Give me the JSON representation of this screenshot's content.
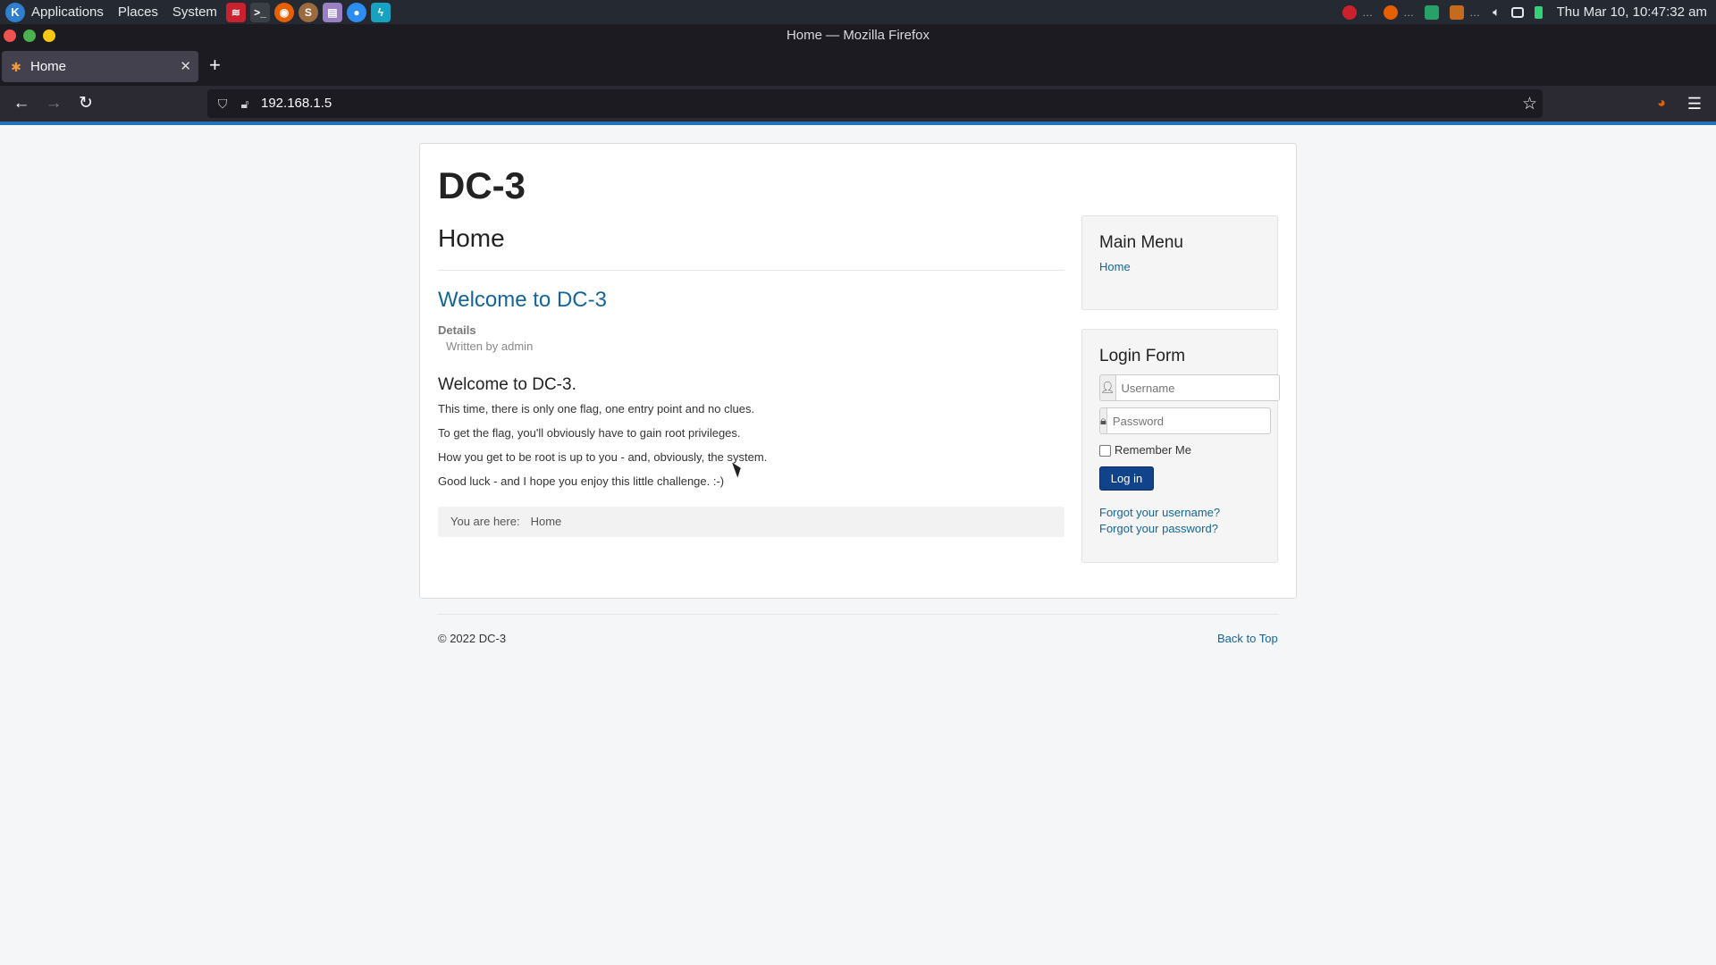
{
  "panel": {
    "applications": "Applications",
    "places": "Places",
    "system": "System",
    "clock": "Thu Mar 10, 10:47:32 am"
  },
  "window": {
    "title": "Home — Mozilla Firefox"
  },
  "browser": {
    "tab_title": "Home",
    "url": "192.168.1.5"
  },
  "site": {
    "brand": "DC-3",
    "page_heading": "Home",
    "article": {
      "title": "Welcome to DC-3",
      "details_label": "Details",
      "written_by": "Written by admin",
      "subtitle": "Welcome to DC-3.",
      "paragraphs": [
        "This time, there is only one flag, one entry point and no clues.",
        "To get the flag, you'll obviously have to gain root privileges.",
        "How you get to be root is up to you - and, obviously, the system.",
        "Good luck - and I hope you enjoy this little challenge.  :-)"
      ]
    },
    "breadcrumb": {
      "label": "You are here:",
      "current": "Home"
    },
    "main_menu": {
      "title": "Main Menu",
      "items": [
        "Home"
      ]
    },
    "login_form": {
      "title": "Login Form",
      "username_placeholder": "Username",
      "password_placeholder": "Password",
      "remember_me": "Remember Me",
      "login_button": "Log in",
      "forgot_username": "Forgot your username?",
      "forgot_password": "Forgot your password?"
    },
    "footer": {
      "copyright": "© 2022 DC-3",
      "back_to_top": "Back to Top"
    }
  },
  "icons": {
    "distro_logo": "kali-logo-icon",
    "user_addon": "user-icon",
    "lock_addon": "lock-icon"
  },
  "colors": {
    "link": "#14659a",
    "login_button": "#10438a",
    "accent_line": "#2373b8"
  }
}
